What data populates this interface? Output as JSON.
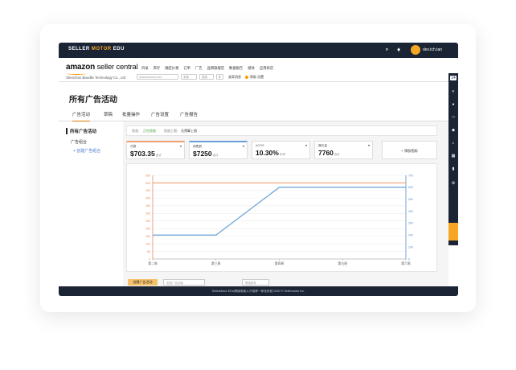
{
  "app": {
    "logo_a": "SELLER ",
    "logo_b": "MOTOR",
    "logo_c": " EDU",
    "username": "dev.tch.tan"
  },
  "amazon": {
    "logo_main": "amazon",
    "logo_sub": " seller central",
    "company": "Shenzhen Baodlie Technology Co., Ltd",
    "menu": [
      "目录",
      "库存",
      "确定价格",
      "订单",
      "广告",
      "品牌旗舰店",
      "数据报告",
      "绩效",
      "应用商店"
    ],
    "search_placeholder": "www.amazon.com",
    "search_select": "卖家",
    "search_button": "搜索",
    "message_link": "卖家消息",
    "help_link": "帮助 设置"
  },
  "page": {
    "title": "所有广告活动"
  },
  "tabs": [
    "广告活动",
    "草稿",
    "批量操作",
    "广告设置",
    "广告报告"
  ],
  "sidebar": {
    "title": "所有广告活动",
    "group": "广告组合",
    "link": "+ 创建广告组合"
  },
  "filter": {
    "label1": "状态:",
    "value1": "正在投放",
    "label2": "投放上限:",
    "value2": "无预算上限"
  },
  "metrics": [
    {
      "label": "花费",
      "value": "$703.35",
      "unit": "合计",
      "color": "#f0a070"
    },
    {
      "label": "销售额",
      "value": "$7250",
      "unit": "合计",
      "color": "#6aa0d8"
    },
    {
      "label": "ACOS",
      "value": "10.30%",
      "unit": "平均",
      "color": "#cccccc"
    },
    {
      "label": "曝光量",
      "value": "7760",
      "unit": "合计",
      "color": "#cccccc"
    }
  ],
  "add_metric": "+ 添加指标",
  "chart_data": {
    "type": "line",
    "categories": [
      "第二周",
      "第三周",
      "第四周",
      "第五周",
      "第六周"
    ],
    "y_left": {
      "ticks": [
        0,
        50,
        100,
        150,
        200,
        250,
        300,
        350,
        400,
        450,
        500,
        550
      ],
      "range": [
        0,
        550
      ]
    },
    "y_right": {
      "ticks": [
        0,
        100,
        200,
        300,
        400,
        500,
        600,
        700
      ],
      "range": [
        0,
        700
      ]
    },
    "series": [
      {
        "axis": "left",
        "color": "#f0a070",
        "values": [
          500,
          500,
          500,
          500,
          500
        ]
      },
      {
        "axis": "right",
        "color": "#6aa0d8",
        "values": [
          200,
          200,
          600,
          600,
          600
        ]
      }
    ]
  },
  "bottom": {
    "create_button": "创建广告活动",
    "search_placeholder": "查找广告活动",
    "filter_placeholder": "筛选条件"
  },
  "footer": "SellerMotor EDU跨境电商人才培养一体化系统 2020 © Sellermotor Inc.",
  "rsidebar": {
    "top_label": "14"
  }
}
